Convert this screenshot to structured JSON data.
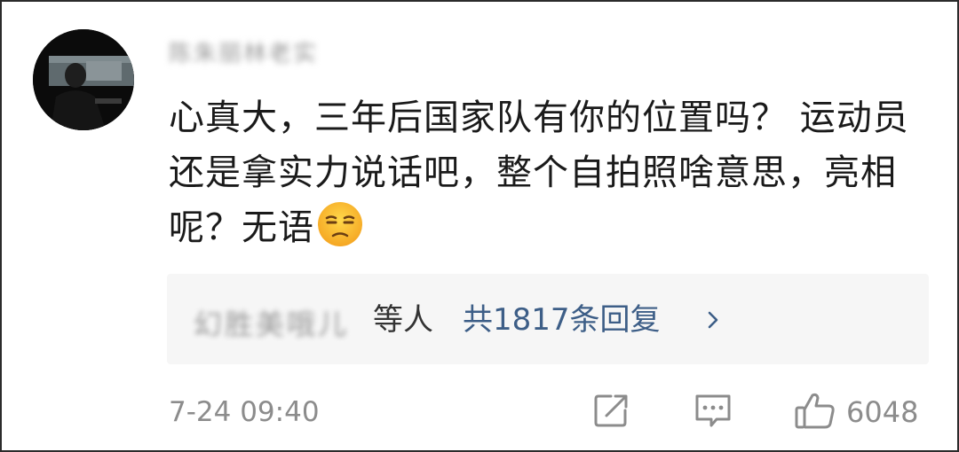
{
  "comment": {
    "username": "陈朱丽林老实",
    "text": "心真大，三年后国家队有你的位置吗？ 运动员还是拿实力说话吧，整个自拍照啥意思，亮相呢？无语",
    "emoji": "unamused-face-emoji"
  },
  "replies": {
    "names": "幻胜美哦儿",
    "suffix": "等人",
    "count_label": "共1817条回复",
    "chevron": "chevron-right-icon"
  },
  "footer": {
    "timestamp": "7-24 09:40",
    "share_icon": "share-icon",
    "comment_icon": "comment-icon",
    "like_icon": "thumbs-up-icon",
    "like_count": "6048"
  },
  "colors": {
    "text": "#1a1a1a",
    "link": "#3d5e87",
    "muted": "#8c8c8c",
    "reply_bg": "#f6f6f6"
  }
}
